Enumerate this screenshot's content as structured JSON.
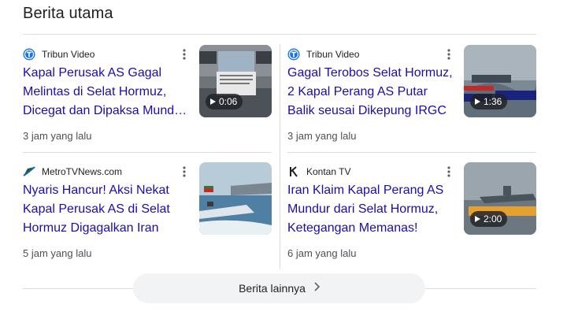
{
  "section": {
    "heading": "Berita utama"
  },
  "articles": [
    {
      "source": "Tribun Video",
      "source_icon": "tribun-logo-icon",
      "title": "Kapal Perusak AS Gagal Melintas di Selat Hormuz, Dicegat dan Dipaksa Mund…",
      "time": "3 jam yang lalu",
      "duration": "0:06"
    },
    {
      "source": "Tribun Video",
      "source_icon": "tribun-logo-icon",
      "title": "Gagal Terobos Selat Hormuz, 2 Kapal Perang AS Putar Balik seusai Dikepung IRGC",
      "time": "3 jam yang lalu",
      "duration": "1:36"
    },
    {
      "source": "MetroTVNews.com",
      "source_icon": "metrotv-logo-icon",
      "title": "Nyaris Hancur! Aksi Nekat Kapal Perusak AS di Selat Hormuz Digagalkan Iran",
      "time": "5 jam yang lalu"
    },
    {
      "source": "Kontan TV",
      "source_icon": "kontan-logo-icon",
      "title": "Iran Klaim Kapal Perang AS Mundur dari Selat Hormuz, Ketegangan Memanas!",
      "time": "6 jam yang lalu",
      "duration": "2:00"
    }
  ],
  "more_button": {
    "label": "Berita lainnya"
  },
  "colors": {
    "link": "#1a0dab",
    "divider": "#dadce0",
    "tribun_blue": "#1a73e8"
  }
}
